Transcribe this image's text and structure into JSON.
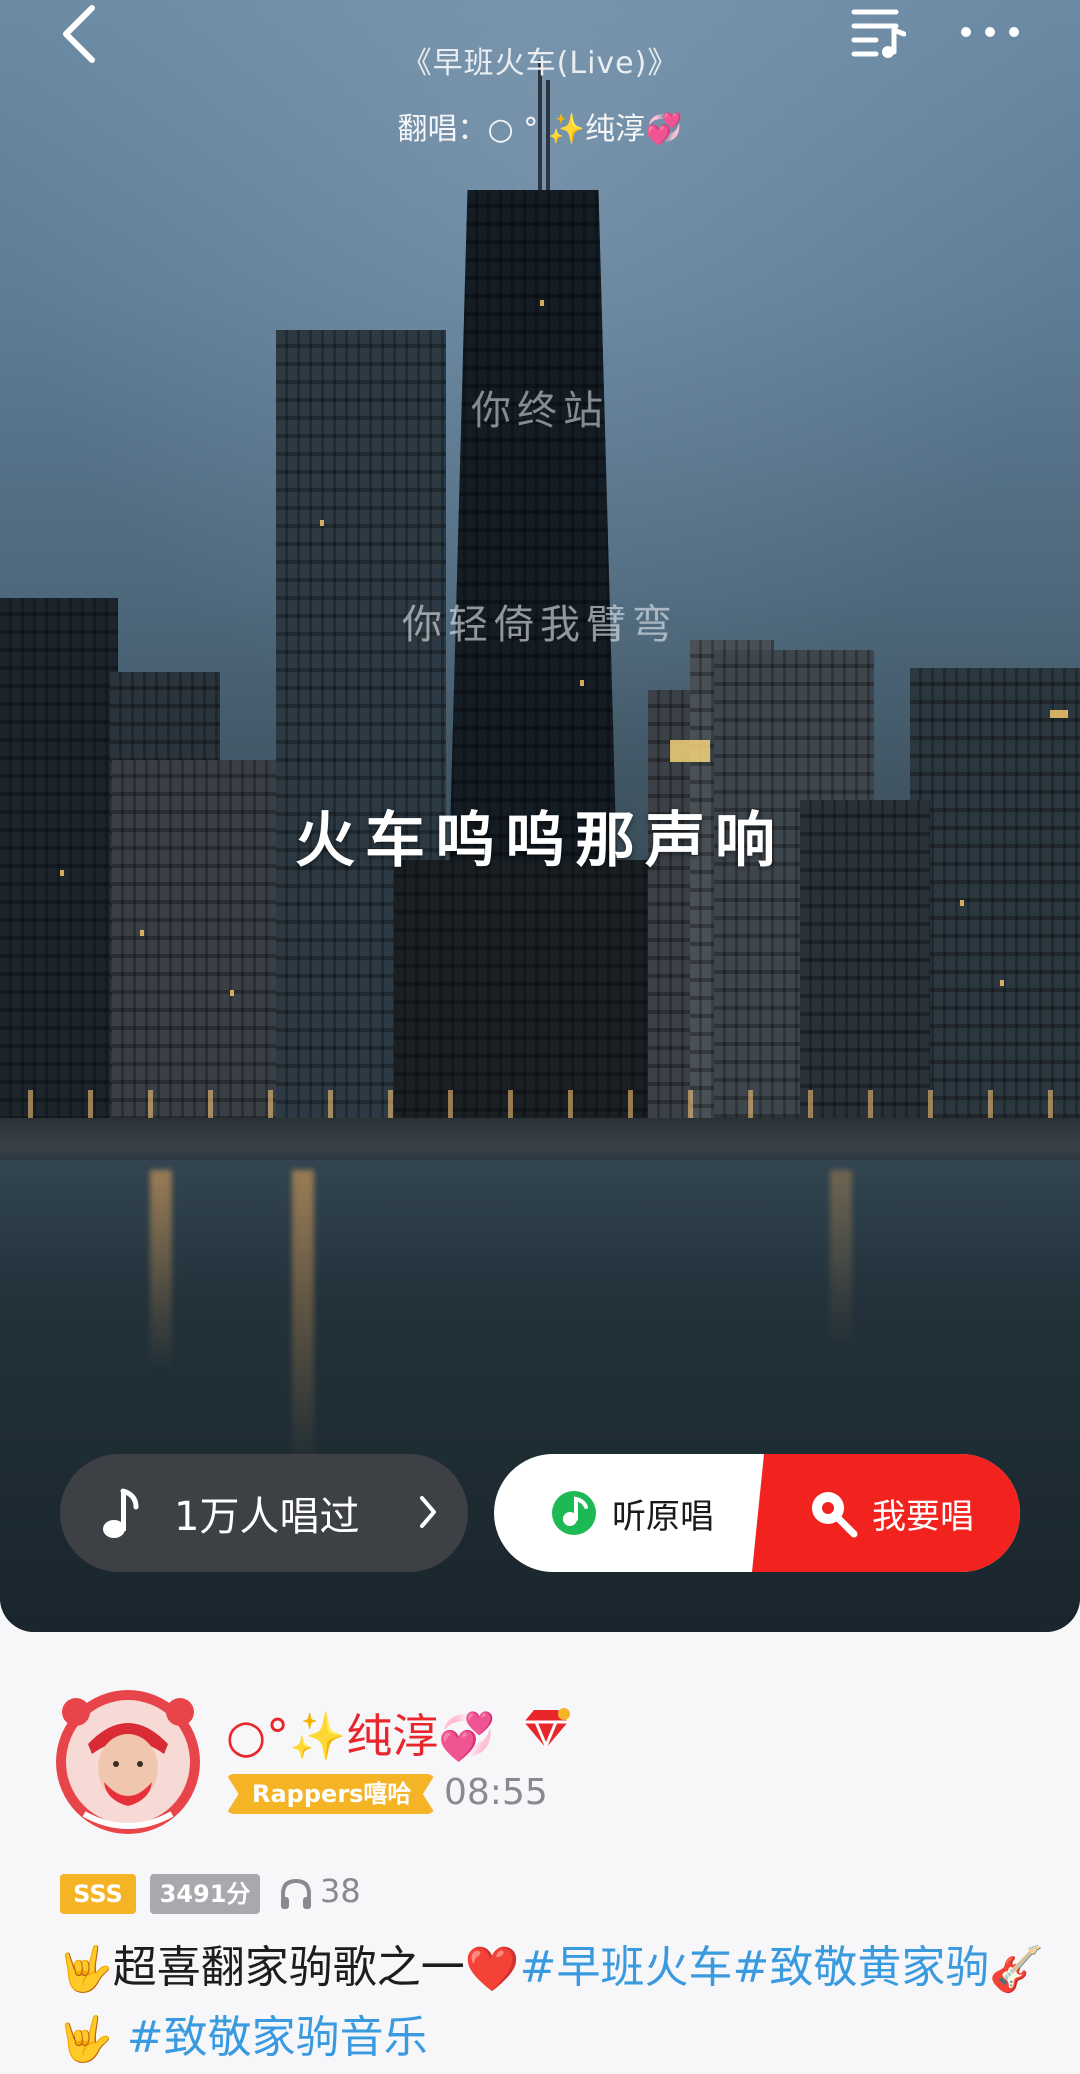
{
  "header": {
    "song_title": "《早班火车(Live)》",
    "cover_label": "翻唱：",
    "cover_artist": "○ ° ✨纯淳💞"
  },
  "lyrics": {
    "previous_1": "你终站",
    "previous_2": "你轻倚我臂弯",
    "current": "火车呜呜那声响"
  },
  "actions": {
    "sung_count": "1万人唱过",
    "listen_original": "听原唱",
    "i_want_sing": "我要唱"
  },
  "user": {
    "name": "○°✨纯淳💞",
    "tag": "Rappers嘻哈",
    "time": "08:55",
    "grade": "SSS",
    "score": "3491分",
    "listen_count": "38"
  },
  "description": {
    "prefix": "超喜翻家驹歌之一",
    "hashtag1": "#早班火车",
    "hashtag2": "#致敬黄家驹",
    "hashtag3": "#致敬家驹音乐"
  },
  "colors": {
    "accent_red": "#f2231f",
    "username_red": "#e8262b",
    "hashtag_blue": "#3a9ae0",
    "badge_gold": "#f5b326"
  }
}
